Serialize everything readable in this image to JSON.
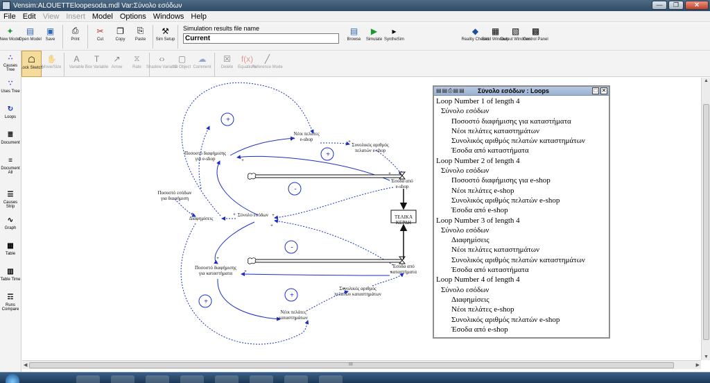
{
  "window": {
    "title": "Vensim:ALOUETTEloopesoda.mdl Var:Σύνολο εσόδων",
    "controls": [
      "minimize",
      "restore",
      "close"
    ]
  },
  "menu": [
    "File",
    "Edit",
    "View",
    "Insert",
    "Model",
    "Options",
    "Windows",
    "Help"
  ],
  "toolbar1": {
    "buttons": [
      {
        "label": "New Model",
        "icon": "new-model-icon"
      },
      {
        "label": "Open Model",
        "icon": "folder-icon"
      },
      {
        "label": "Save",
        "icon": "floppy-icon"
      },
      {
        "label": "Print",
        "icon": "printer-icon"
      },
      {
        "label": "Cut",
        "icon": "scissors-icon"
      },
      {
        "label": "Copy",
        "icon": "copy-icon"
      },
      {
        "label": "Paste",
        "icon": "clipboard-icon"
      },
      {
        "label": "Sim Setup",
        "icon": "sim-setup-icon"
      }
    ],
    "sim_file_label": "Simulation results file name",
    "sim_file_value": "Current",
    "buttons_right": [
      {
        "label": "Browse",
        "icon": "folder-icon"
      },
      {
        "label": "Simulate",
        "icon": "play-icon"
      },
      {
        "label": "SyntheSim",
        "icon": "synthesim-icon"
      },
      {
        "label": "Reality Checks",
        "icon": "reality-check-icon"
      },
      {
        "label": "Build Windows",
        "icon": "build-windows-icon"
      },
      {
        "label": "Output Windows",
        "icon": "output-windows-icon"
      },
      {
        "label": "Control Panel",
        "icon": "control-panel-icon"
      }
    ]
  },
  "toolbar2": {
    "buttons": [
      {
        "label": "Lock Sketch",
        "icon": "lock-icon"
      },
      {
        "label": "Move/Size",
        "icon": "hand-icon"
      },
      {
        "label": "Variable",
        "icon": "variable-icon"
      },
      {
        "label": "Box Variable",
        "icon": "box-variable-icon"
      },
      {
        "label": "Arrow",
        "icon": "arrow-icon"
      },
      {
        "label": "Rate",
        "icon": "rate-icon"
      },
      {
        "label": "Shadow Variable",
        "icon": "shadow-variable-icon"
      },
      {
        "label": "IO Object",
        "icon": "io-object-icon"
      },
      {
        "label": "Comment",
        "icon": "comment-icon"
      },
      {
        "label": "Delete",
        "icon": "trash-icon"
      },
      {
        "label": "Equations",
        "icon": "function-icon"
      },
      {
        "label": "Reference Mode",
        "icon": "reference-mode-icon"
      }
    ]
  },
  "left_tools": [
    {
      "label": "Causes Tree",
      "icon": "causes-tree-icon"
    },
    {
      "label": "Uses Tree",
      "icon": "uses-tree-icon"
    },
    {
      "label": "Loops",
      "icon": "loops-icon"
    },
    {
      "label": "Document",
      "icon": "document-icon"
    },
    {
      "label": "Document All",
      "icon": "document-all-icon"
    },
    {
      "label": "Causes Strip",
      "icon": "causes-strip-icon"
    },
    {
      "label": "Graph",
      "icon": "graph-icon"
    },
    {
      "label": "Table",
      "icon": "table-icon"
    },
    {
      "label": "Table Time",
      "icon": "table-time-icon"
    },
    {
      "label": "Runs Compare",
      "icon": "runs-compare-icon"
    }
  ],
  "diagram": {
    "variables": {
      "neoi_eshop": [
        "Νέοι πελάτες",
        "e-shop"
      ],
      "synolikos_eshop": [
        "Συνολικός αριθμός",
        "πελατών e-shop"
      ],
      "pososto_eshop": [
        "Ποσοστό διαφήμισης",
        "για e-shop"
      ],
      "esoda_eshop": [
        "Έσοδα από",
        "e-shop"
      ],
      "pososto_esodon_diafimisi": [
        "Ποσοστό εσόδων",
        "για διαφήμιση"
      ],
      "diafimiseis": [
        "Διαφημίσεις"
      ],
      "synolo_esodon": [
        "Σύνολο εσόδων"
      ],
      "telika_kerdi": [
        "ΤΕΛΙΚΑ",
        "ΚΕΡΔΗ"
      ],
      "pososto_katastimata": [
        "Ποσοστό διαφήμισης",
        "για καταστήματα"
      ],
      "esoda_katastimata": [
        "Έσοδα από",
        "καταστήματα"
      ],
      "synolikos_katastimata": [
        "Συνολικός αριθμός",
        "πελατών καταστημάτων"
      ],
      "neoi_katastimata": [
        "Νέοι πελάτες",
        "καταστημάτων"
      ]
    },
    "loop_markers": [
      "+",
      "+",
      "-",
      "-",
      "+",
      "+"
    ],
    "link_signs": [
      "+",
      "+",
      "+",
      "+",
      "+",
      "+",
      "+",
      "+",
      "+",
      "+",
      "+",
      "+",
      "+",
      "+"
    ]
  },
  "loops_window": {
    "title": "Σύνολο εσόδων : Loops",
    "lines": [
      {
        "text": "Loop Number 1 of length 4",
        "level": 0
      },
      {
        "text": "Σύνολο εσόδων",
        "level": 1
      },
      {
        "text": "Ποσοστό διαφήμισης για καταστήματα",
        "level": 2
      },
      {
        "text": "Νέοι πελάτες καταστημάτων",
        "level": 2
      },
      {
        "text": "Συνολικός αριθμός πελατών καταστημάτων",
        "level": 2
      },
      {
        "text": "Έσοδα από καταστήματα",
        "level": 2
      },
      {
        "text": "Loop Number 2 of length 4",
        "level": 0
      },
      {
        "text": "Σύνολο εσόδων",
        "level": 1
      },
      {
        "text": "Ποσοστό διαφήμισης για e-shop",
        "level": 2
      },
      {
        "text": "Νέοι πελάτες e-shop",
        "level": 2
      },
      {
        "text": "Συνολικός αριθμός πελατών e-shop",
        "level": 2
      },
      {
        "text": "Έσοδα από e-shop",
        "level": 2
      },
      {
        "text": "Loop Number 3 of length 4",
        "level": 0
      },
      {
        "text": "Σύνολο εσόδων",
        "level": 1
      },
      {
        "text": "Διαφημίσεις",
        "level": 2
      },
      {
        "text": "Νέοι πελάτες καταστημάτων",
        "level": 2
      },
      {
        "text": "Συνολικός αριθμός πελατών καταστημάτων",
        "level": 2
      },
      {
        "text": "Έσοδα από καταστήματα",
        "level": 2
      },
      {
        "text": "Loop Number 4 of length 4",
        "level": 0
      },
      {
        "text": "Σύνολο εσόδων",
        "level": 1
      },
      {
        "text": "Διαφημίσεις",
        "level": 2
      },
      {
        "text": "Νέοι πελάτες e-shop",
        "level": 2
      },
      {
        "text": "Συνολικός αριθμός πελατών e-shop",
        "level": 2
      },
      {
        "text": "Έσοδα από e-shop",
        "level": 2
      }
    ]
  },
  "scrollbar_h_grip": "III",
  "colors": {
    "link_blue": "#1a2fc9",
    "title_bar": "#3d5a78",
    "loops_title": "#a8bcd9",
    "active_tool": "#f6dc9c"
  }
}
